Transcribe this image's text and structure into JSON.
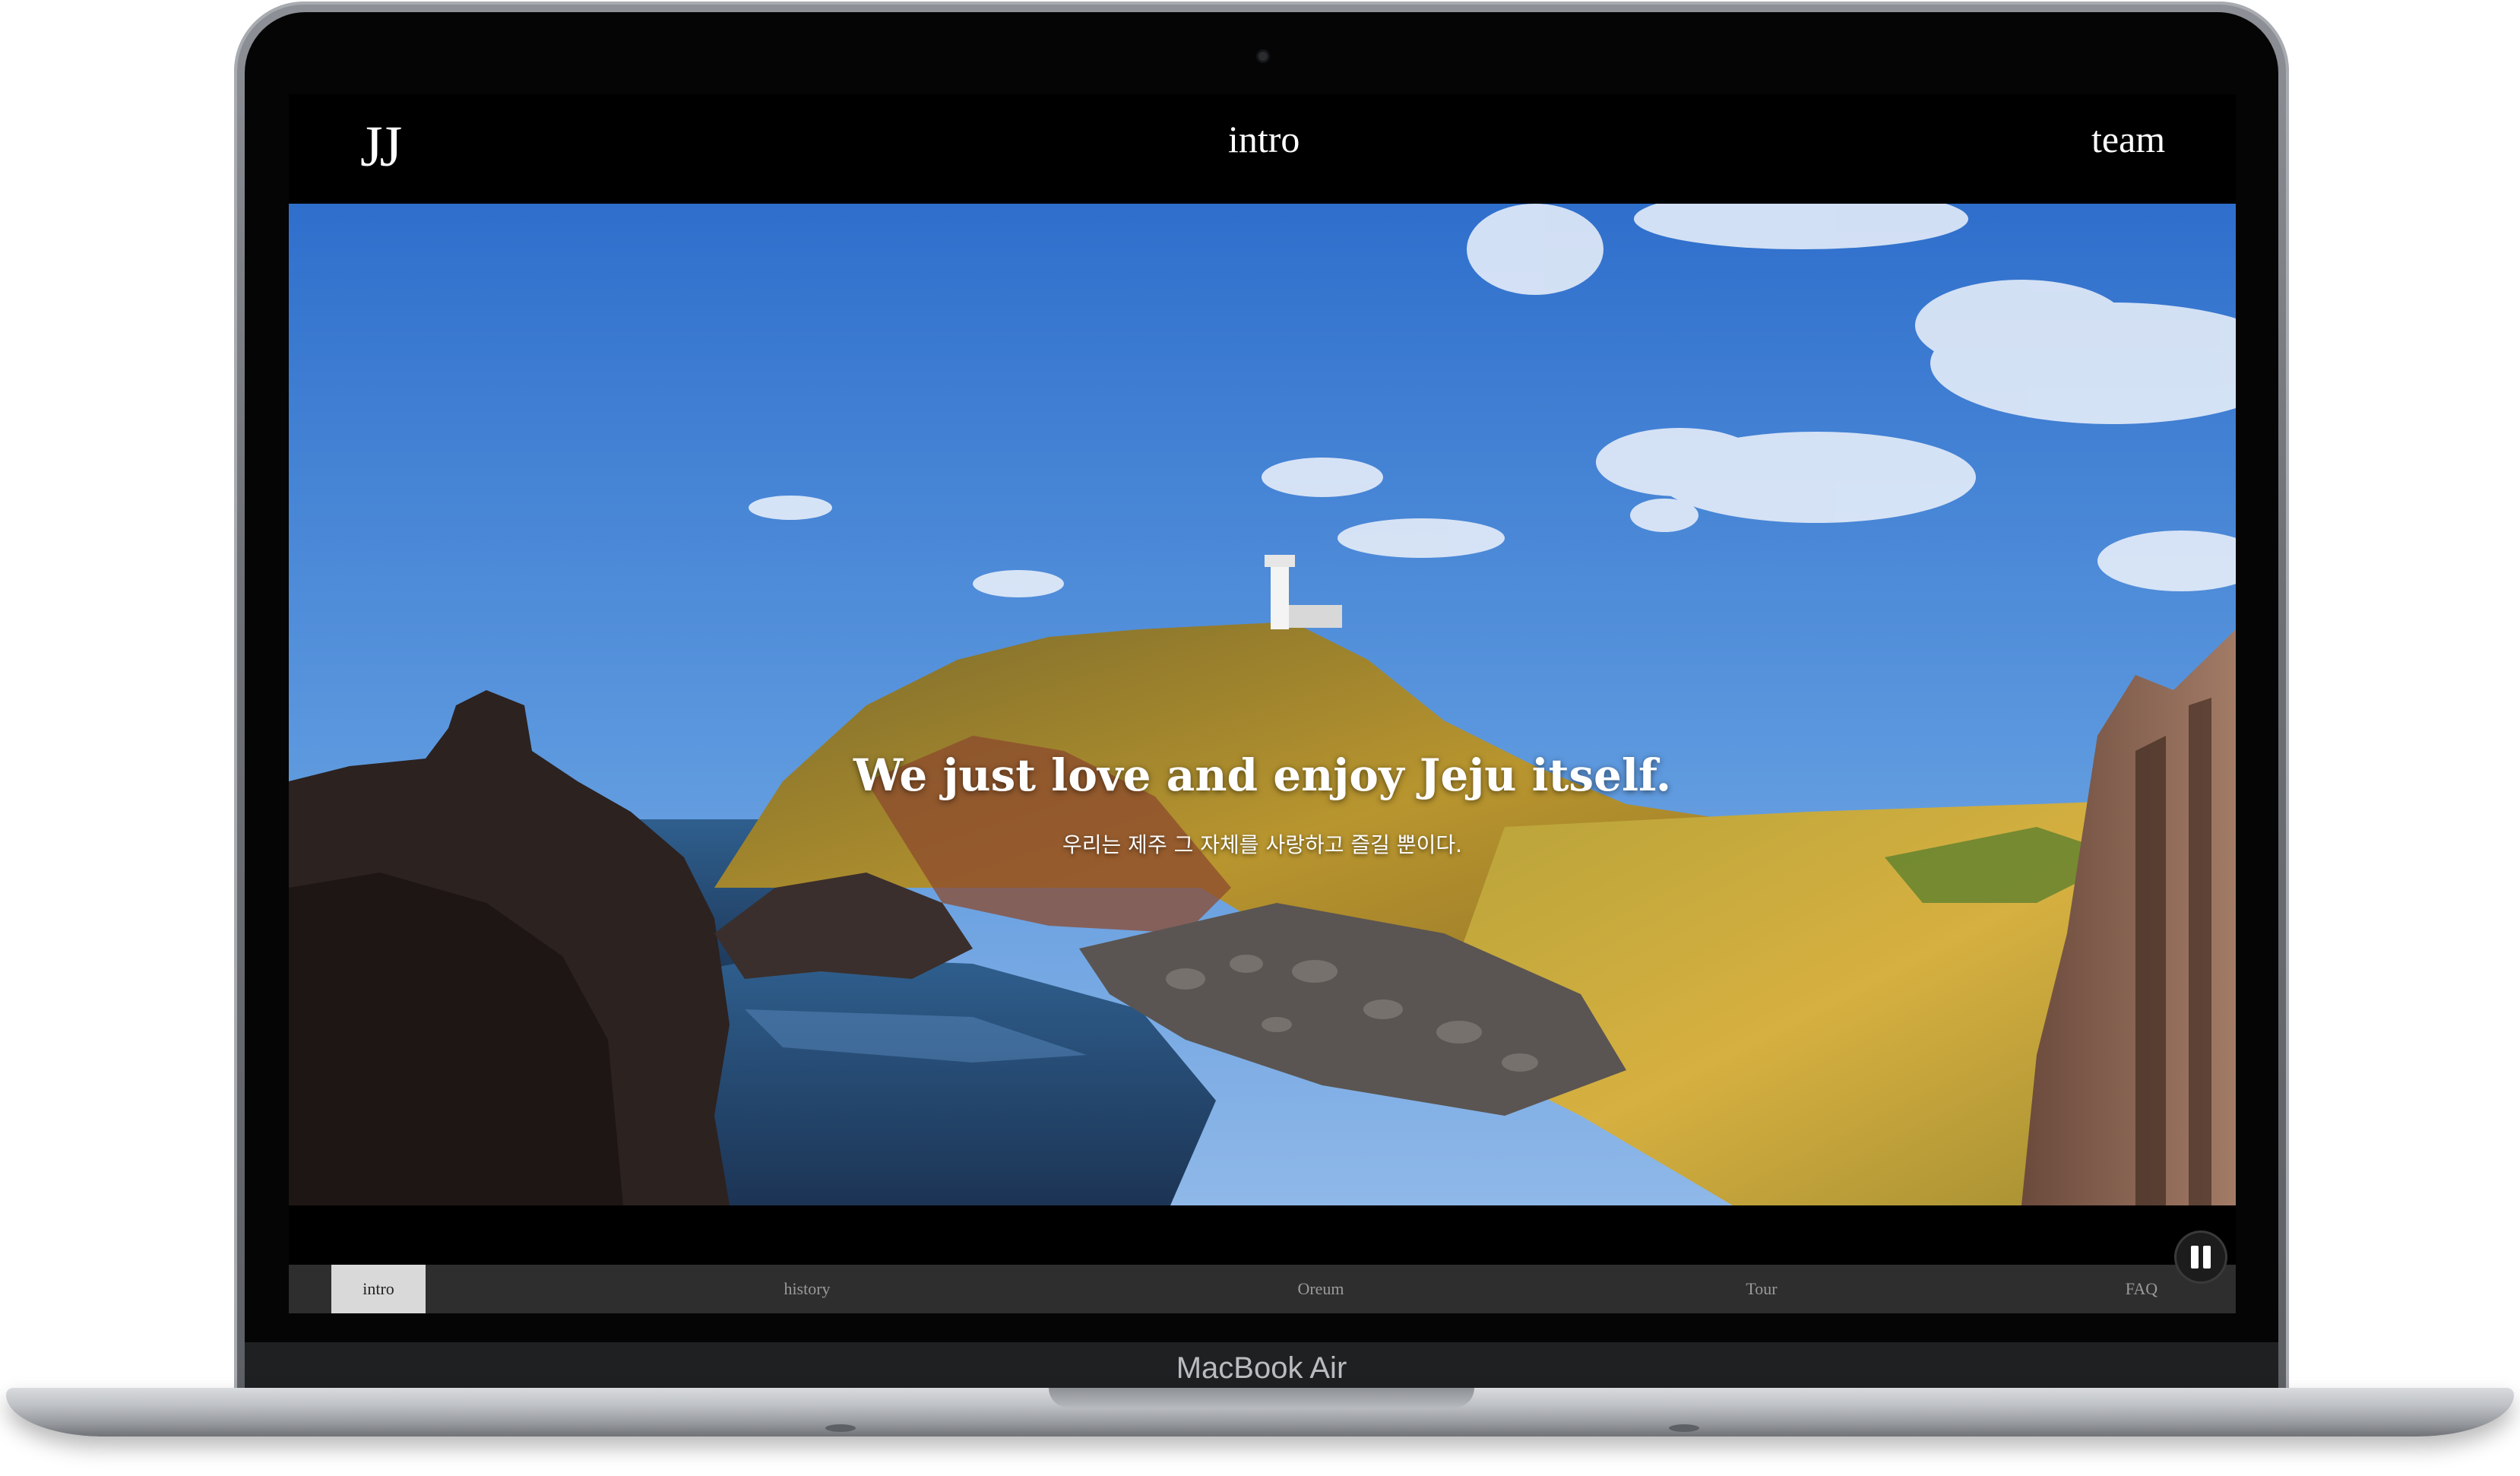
{
  "site": {
    "logo": "JJ",
    "nav": {
      "intro": "intro",
      "team": "team"
    }
  },
  "hero": {
    "headline": "We just love and enjoy Jeju itself.",
    "subline": "우리는 제주 그 자체를 사랑하고 즐길 뿐이다."
  },
  "tabs": [
    {
      "label": "intro",
      "active": true
    },
    {
      "label": "history",
      "active": false
    },
    {
      "label": "Oreum",
      "active": false
    },
    {
      "label": "Tour",
      "active": false
    },
    {
      "label": "FAQ",
      "active": false
    }
  ],
  "controls": {
    "pause_icon": "pause-icon"
  },
  "device": {
    "label": "MacBook Air"
  },
  "colors": {
    "sky": "#4c88d6",
    "sea": "#2e5a88",
    "grass": "#c9a238",
    "rock": "#3a2f2c",
    "tab_active_bg": "#d9d9d9",
    "tab_bar_bg": "#2e2e2e"
  }
}
